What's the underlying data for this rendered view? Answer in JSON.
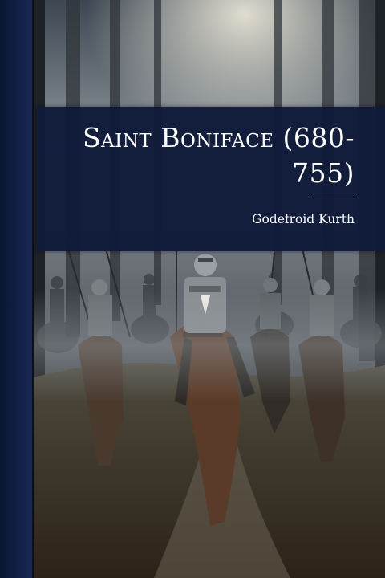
{
  "book": {
    "title": "Saint Boniface (680-755)",
    "title_line1": "Saint Boniface (680-",
    "title_line2": "755)",
    "author": "Godefroid Kurth"
  },
  "colors": {
    "spine": "#0a1630",
    "title_band": "#0f1b3a",
    "text": "#ffffff"
  },
  "illustration": {
    "subject": "armored-knights-on-horseback-in-misty-forest"
  }
}
